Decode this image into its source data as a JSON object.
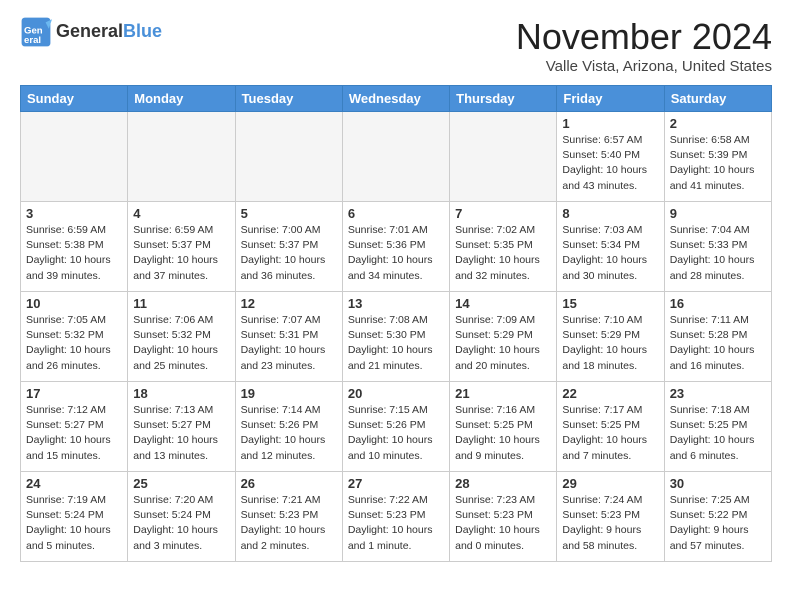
{
  "header": {
    "logo_general": "General",
    "logo_blue": "Blue",
    "month": "November 2024",
    "location": "Valle Vista, Arizona, United States"
  },
  "days_of_week": [
    "Sunday",
    "Monday",
    "Tuesday",
    "Wednesday",
    "Thursday",
    "Friday",
    "Saturday"
  ],
  "weeks": [
    [
      {
        "day": "",
        "empty": true
      },
      {
        "day": "",
        "empty": true
      },
      {
        "day": "",
        "empty": true
      },
      {
        "day": "",
        "empty": true
      },
      {
        "day": "",
        "empty": true
      },
      {
        "day": "1",
        "sunrise": "Sunrise: 6:57 AM",
        "sunset": "Sunset: 5:40 PM",
        "daylight": "Daylight: 10 hours and 43 minutes."
      },
      {
        "day": "2",
        "sunrise": "Sunrise: 6:58 AM",
        "sunset": "Sunset: 5:39 PM",
        "daylight": "Daylight: 10 hours and 41 minutes."
      }
    ],
    [
      {
        "day": "3",
        "sunrise": "Sunrise: 6:59 AM",
        "sunset": "Sunset: 5:38 PM",
        "daylight": "Daylight: 10 hours and 39 minutes."
      },
      {
        "day": "4",
        "sunrise": "Sunrise: 6:59 AM",
        "sunset": "Sunset: 5:37 PM",
        "daylight": "Daylight: 10 hours and 37 minutes."
      },
      {
        "day": "5",
        "sunrise": "Sunrise: 7:00 AM",
        "sunset": "Sunset: 5:37 PM",
        "daylight": "Daylight: 10 hours and 36 minutes."
      },
      {
        "day": "6",
        "sunrise": "Sunrise: 7:01 AM",
        "sunset": "Sunset: 5:36 PM",
        "daylight": "Daylight: 10 hours and 34 minutes."
      },
      {
        "day": "7",
        "sunrise": "Sunrise: 7:02 AM",
        "sunset": "Sunset: 5:35 PM",
        "daylight": "Daylight: 10 hours and 32 minutes."
      },
      {
        "day": "8",
        "sunrise": "Sunrise: 7:03 AM",
        "sunset": "Sunset: 5:34 PM",
        "daylight": "Daylight: 10 hours and 30 minutes."
      },
      {
        "day": "9",
        "sunrise": "Sunrise: 7:04 AM",
        "sunset": "Sunset: 5:33 PM",
        "daylight": "Daylight: 10 hours and 28 minutes."
      }
    ],
    [
      {
        "day": "10",
        "sunrise": "Sunrise: 7:05 AM",
        "sunset": "Sunset: 5:32 PM",
        "daylight": "Daylight: 10 hours and 26 minutes."
      },
      {
        "day": "11",
        "sunrise": "Sunrise: 7:06 AM",
        "sunset": "Sunset: 5:32 PM",
        "daylight": "Daylight: 10 hours and 25 minutes."
      },
      {
        "day": "12",
        "sunrise": "Sunrise: 7:07 AM",
        "sunset": "Sunset: 5:31 PM",
        "daylight": "Daylight: 10 hours and 23 minutes."
      },
      {
        "day": "13",
        "sunrise": "Sunrise: 7:08 AM",
        "sunset": "Sunset: 5:30 PM",
        "daylight": "Daylight: 10 hours and 21 minutes."
      },
      {
        "day": "14",
        "sunrise": "Sunrise: 7:09 AM",
        "sunset": "Sunset: 5:29 PM",
        "daylight": "Daylight: 10 hours and 20 minutes."
      },
      {
        "day": "15",
        "sunrise": "Sunrise: 7:10 AM",
        "sunset": "Sunset: 5:29 PM",
        "daylight": "Daylight: 10 hours and 18 minutes."
      },
      {
        "day": "16",
        "sunrise": "Sunrise: 7:11 AM",
        "sunset": "Sunset: 5:28 PM",
        "daylight": "Daylight: 10 hours and 16 minutes."
      }
    ],
    [
      {
        "day": "17",
        "sunrise": "Sunrise: 7:12 AM",
        "sunset": "Sunset: 5:27 PM",
        "daylight": "Daylight: 10 hours and 15 minutes."
      },
      {
        "day": "18",
        "sunrise": "Sunrise: 7:13 AM",
        "sunset": "Sunset: 5:27 PM",
        "daylight": "Daylight: 10 hours and 13 minutes."
      },
      {
        "day": "19",
        "sunrise": "Sunrise: 7:14 AM",
        "sunset": "Sunset: 5:26 PM",
        "daylight": "Daylight: 10 hours and 12 minutes."
      },
      {
        "day": "20",
        "sunrise": "Sunrise: 7:15 AM",
        "sunset": "Sunset: 5:26 PM",
        "daylight": "Daylight: 10 hours and 10 minutes."
      },
      {
        "day": "21",
        "sunrise": "Sunrise: 7:16 AM",
        "sunset": "Sunset: 5:25 PM",
        "daylight": "Daylight: 10 hours and 9 minutes."
      },
      {
        "day": "22",
        "sunrise": "Sunrise: 7:17 AM",
        "sunset": "Sunset: 5:25 PM",
        "daylight": "Daylight: 10 hours and 7 minutes."
      },
      {
        "day": "23",
        "sunrise": "Sunrise: 7:18 AM",
        "sunset": "Sunset: 5:25 PM",
        "daylight": "Daylight: 10 hours and 6 minutes."
      }
    ],
    [
      {
        "day": "24",
        "sunrise": "Sunrise: 7:19 AM",
        "sunset": "Sunset: 5:24 PM",
        "daylight": "Daylight: 10 hours and 5 minutes."
      },
      {
        "day": "25",
        "sunrise": "Sunrise: 7:20 AM",
        "sunset": "Sunset: 5:24 PM",
        "daylight": "Daylight: 10 hours and 3 minutes."
      },
      {
        "day": "26",
        "sunrise": "Sunrise: 7:21 AM",
        "sunset": "Sunset: 5:23 PM",
        "daylight": "Daylight: 10 hours and 2 minutes."
      },
      {
        "day": "27",
        "sunrise": "Sunrise: 7:22 AM",
        "sunset": "Sunset: 5:23 PM",
        "daylight": "Daylight: 10 hours and 1 minute."
      },
      {
        "day": "28",
        "sunrise": "Sunrise: 7:23 AM",
        "sunset": "Sunset: 5:23 PM",
        "daylight": "Daylight: 10 hours and 0 minutes."
      },
      {
        "day": "29",
        "sunrise": "Sunrise: 7:24 AM",
        "sunset": "Sunset: 5:23 PM",
        "daylight": "Daylight: 9 hours and 58 minutes."
      },
      {
        "day": "30",
        "sunrise": "Sunrise: 7:25 AM",
        "sunset": "Sunset: 5:22 PM",
        "daylight": "Daylight: 9 hours and 57 minutes."
      }
    ]
  ]
}
